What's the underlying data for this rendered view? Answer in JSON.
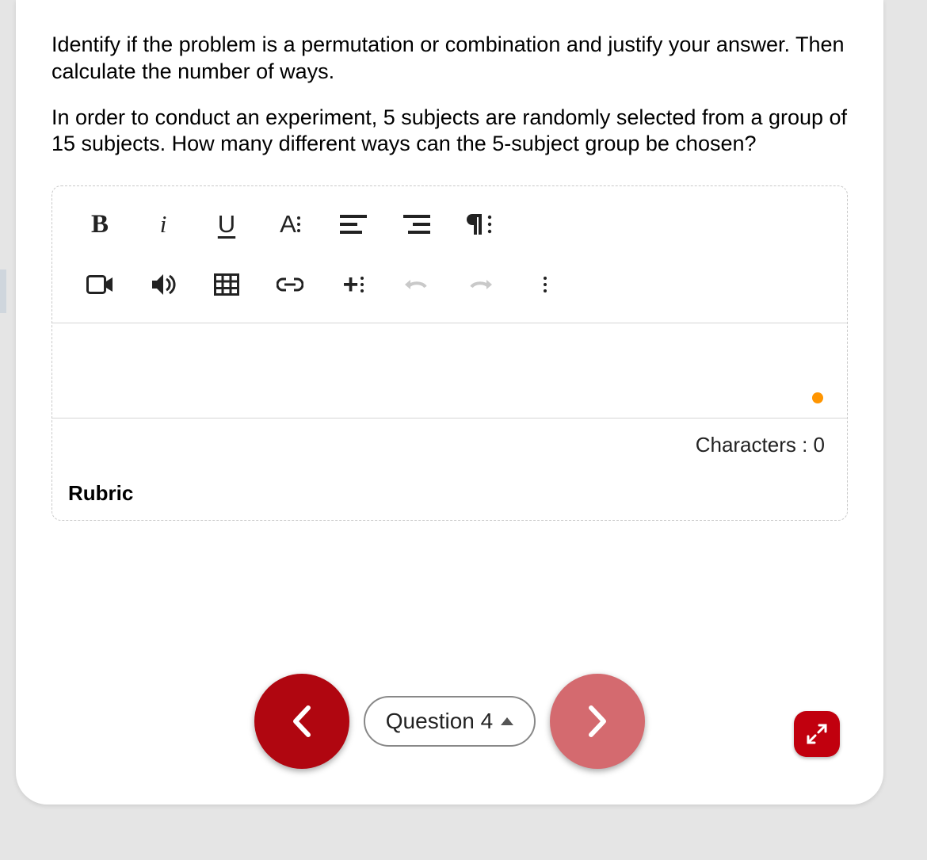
{
  "question": {
    "para1": "Identify if the problem is a permutation or combination and justify your answer. Then calculate the number of ways.",
    "para2": "In order to conduct an experiment, 5 subjects are randomly selected from a group of 15 subjects.  How many different ways can the 5-subject group be chosen?"
  },
  "toolbar": {
    "bold": "B",
    "italic": "i",
    "underline": "U",
    "font": "A",
    "plus": "+"
  },
  "counter": {
    "label": "Characters : ",
    "value": "0"
  },
  "rubric_label": "Rubric",
  "nav": {
    "question_label": "Question 4"
  }
}
